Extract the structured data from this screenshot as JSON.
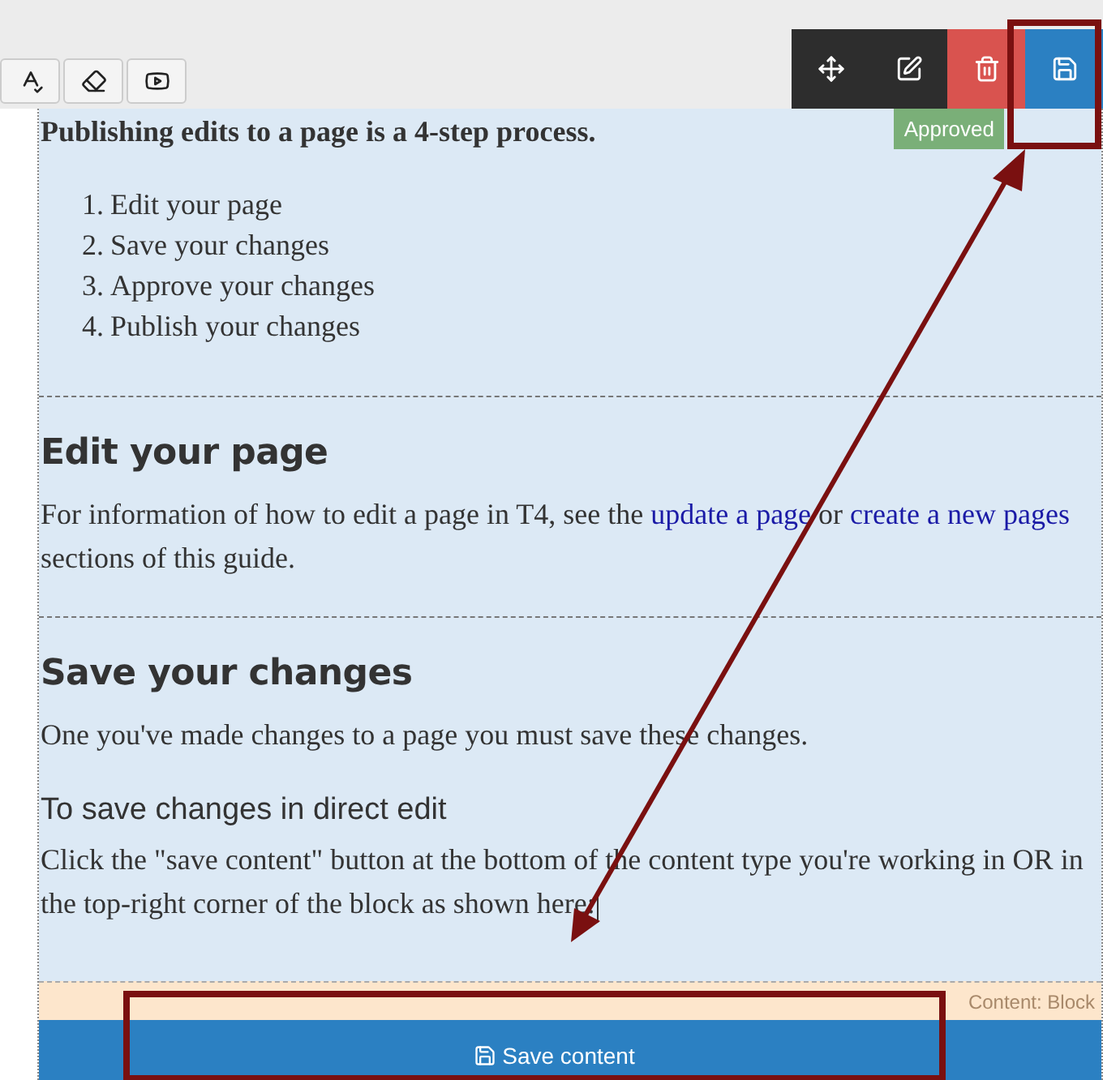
{
  "format_toolbar": {
    "buttons": [
      {
        "kind": "spellcheck"
      },
      {
        "kind": "eraser"
      },
      {
        "kind": "video"
      }
    ]
  },
  "block_toolbar": {
    "buttons": [
      {
        "kind": "move"
      },
      {
        "kind": "edit"
      },
      {
        "kind": "delete"
      },
      {
        "kind": "save"
      }
    ]
  },
  "status_badge": "Approved",
  "content": [
    {
      "kind": "lead",
      "text": "Publishing edits to a page is a 4-step process."
    },
    {
      "kind": "list",
      "items": [
        {
          "marker": "1.",
          "text": "Edit your page"
        },
        {
          "marker": "2.",
          "text": "Save your changes"
        },
        {
          "marker": "3.",
          "text": "Approve your changes"
        },
        {
          "marker": "4.",
          "text": "Publish your changes"
        }
      ]
    },
    {
      "kind": "divider"
    },
    {
      "kind": "heading",
      "text": "Edit your page"
    },
    {
      "kind": "paragraph",
      "segments": [
        {
          "kind": "text",
          "text": "For information of how to edit a page in T4, see the "
        },
        {
          "kind": "link",
          "text": "update a page"
        },
        {
          "kind": "text",
          "text": " or "
        },
        {
          "kind": "link",
          "text": "create a new pages"
        },
        {
          "kind": "text",
          "text": " sections of this guide."
        }
      ]
    },
    {
      "kind": "divider"
    },
    {
      "kind": "heading",
      "text": "Save your changes"
    },
    {
      "kind": "paragraph",
      "segments": [
        {
          "kind": "text",
          "text": "One you've made changes to a page you must save these changes."
        }
      ]
    },
    {
      "kind": "subheading",
      "text": "To save changes in direct edit"
    },
    {
      "kind": "paragraph",
      "cursor": true,
      "segments": [
        {
          "kind": "text",
          "text": "Click the \"save content\" button at the bottom of the content type you're working in OR in the top-right corner of the block as shown here:"
        }
      ]
    }
  ],
  "content_type_label": "Content: Block",
  "save_button": "Save content"
}
